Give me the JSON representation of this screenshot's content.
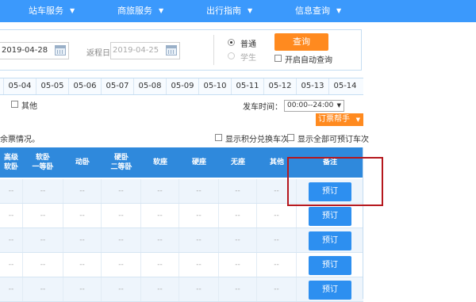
{
  "nav": {
    "items": [
      {
        "label": "站车服务"
      },
      {
        "label": "商旅服务"
      },
      {
        "label": "出行指南"
      },
      {
        "label": "信息查询"
      }
    ],
    "chevron": "▼"
  },
  "search": {
    "depart_date": "2019-04-28",
    "return_label": "返程日",
    "return_date": "2019-04-25",
    "ticket_types": [
      {
        "label": "普通",
        "selected": true
      },
      {
        "label": "学生",
        "selected": false,
        "disabled": true
      }
    ],
    "query_label": "查询",
    "auto_query_label": "开启自动查询"
  },
  "dates": [
    "05-04",
    "05-05",
    "05-06",
    "05-07",
    "05-08",
    "05-09",
    "05-10",
    "05-11",
    "05-12",
    "05-13",
    "05-14"
  ],
  "filters": {
    "other_label": "其他",
    "depart_time_label": "发车时间：",
    "depart_time_value": "00:00--24:00",
    "helper_label": "订票帮手"
  },
  "notice": {
    "text": "余票情况。",
    "points_label": "显示积分兑换车次",
    "all_label": "显示全部可预订车次"
  },
  "table": {
    "headers": [
      {
        "l1": "高级",
        "l2": "软卧"
      },
      {
        "l1": "软卧",
        "l2": "一等卧"
      },
      {
        "l1": "动卧",
        "l2": ""
      },
      {
        "l1": "硬卧",
        "l2": "二等卧"
      },
      {
        "l1": "软座",
        "l2": ""
      },
      {
        "l1": "硬座",
        "l2": ""
      },
      {
        "l1": "无座",
        "l2": ""
      },
      {
        "l1": "其他",
        "l2": ""
      },
      {
        "l1": "备注",
        "l2": ""
      }
    ],
    "empty_cell": "--",
    "book_label": "预订",
    "row_count": 5
  },
  "colors": {
    "nav_bg": "#3b99fc",
    "header_bg": "#2f89dc",
    "accent_orange": "#ff8a1f",
    "book_button": "#2d8ff0",
    "highlight_red": "#b5171d"
  }
}
